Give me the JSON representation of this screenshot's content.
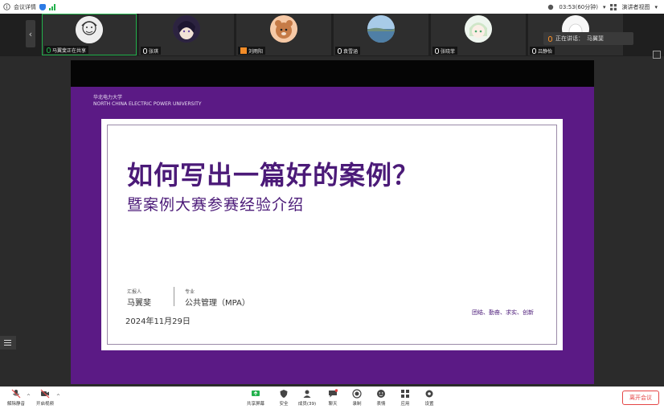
{
  "topbar": {
    "title": "会议详情",
    "time": "03:53(60分钟)",
    "view_label": "演讲者视图",
    "icons": [
      "info-icon",
      "shield-icon",
      "signal-icon",
      "recording-icon",
      "dropdown-icon",
      "grid-icon"
    ]
  },
  "participants": [
    {
      "name": "马翼斐正在共享",
      "avatar": "sketch-portrait"
    },
    {
      "name": "张琪",
      "avatar": "anime-dark"
    },
    {
      "name": "刘雨阳",
      "avatar": "cartoon-bear"
    },
    {
      "name": "袁雪涵",
      "avatar": "sea-photo"
    },
    {
      "name": "张晓菲",
      "avatar": "anime-green"
    },
    {
      "name": "吕静怡",
      "avatar": "white-character"
    }
  ],
  "speaking": {
    "label": "正在讲话：",
    "name": "马翼斐"
  },
  "slide": {
    "university_cn": "华北电力大学",
    "university_en": "NORTH CHINA ELECTRIC POWER UNIVERSITY",
    "title": "如何写出一篇好的案例？",
    "subtitle": "暨案例大赛参赛经验介绍",
    "reporter_label": "汇报人",
    "reporter": "马翼斐",
    "major_label": "专业",
    "major": "公共管理（MPA）",
    "date": "2024年11月29日",
    "motto": "团结、勤奋、求实、创新"
  },
  "toolbar": {
    "mute": "解除静音",
    "video": "开启视频",
    "share": "共享屏幕",
    "security": "安全",
    "participants": "成员(39)",
    "chat": "聊天",
    "record": "录制",
    "reactions": "表情",
    "apps": "应用",
    "settings": "设置",
    "leave": "离开会议"
  },
  "colors": {
    "slide_purple": "#5b1a85",
    "title_purple": "#4b1a78",
    "active_green": "#22b14c",
    "leave_red": "#e54545"
  }
}
